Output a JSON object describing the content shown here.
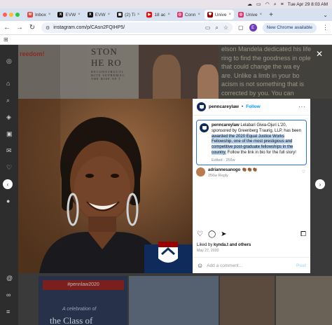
{
  "menubar": {
    "datetime": "Tue Apr 29  8:03 AM"
  },
  "tabs": [
    {
      "label": "Inbox",
      "color": "#ea4335",
      "glyph": "M"
    },
    {
      "label": "EVW",
      "color": "#111111",
      "glyph": "X"
    },
    {
      "label": "EVW",
      "color": "#111111",
      "glyph": "X"
    },
    {
      "label": "(2) Ti",
      "color": "#111111",
      "glyph": "▣"
    },
    {
      "label": "18 ac",
      "color": "#ff0000",
      "glyph": "▶"
    },
    {
      "label": "Conn",
      "color": "#e1306c",
      "glyph": "◎"
    },
    {
      "label": "Unive",
      "color": "#990000",
      "glyph": "⛊"
    },
    {
      "label": "Unive",
      "color": "#e1306c",
      "glyph": "◎"
    }
  ],
  "toolbar": {
    "url": "instagram.com/p/CAsn2FQIHP5/",
    "profile_initial": "E",
    "new_chrome": "New Chrome available"
  },
  "background": {
    "freedom": "reedom!",
    "stone_line1": "STON",
    "stone_line2": "HE RO",
    "stone_line3": "RECONSTRUCTI",
    "stone_line4": "HITE SUPREMAC",
    "stone_line5": "THE RISE OF J",
    "mandela_text": "elson Mandela dedicated his life ring to find the goodness in ople that could change the wa ey are. Unlike a limb in your bo acism is not something that is corrected by you. You can actually",
    "hashtag": "#pennlaw2020",
    "celebration": "A celebration of",
    "class_of": "the Class of"
  },
  "post": {
    "username": "penncareylaw",
    "follow_label": "Follow",
    "caption_user": "penncareylaw",
    "caption_before": " Lelabari Giwa-Ojuri L'20, sponsored by Greenberg Traurig, LLP, has been ",
    "caption_highlight": "awarded the 2020 Equal Justice Works Fellowship, one of the most prestigious and competitive post-graduate fellowships in the country.",
    "caption_after": " Follow the link in bio for the full story!",
    "caption_meta": "Edited · 256w",
    "comment_user": "adriannesanogo",
    "comment_text": "👏🏾👏🏾👏🏾",
    "comment_meta": "256w   Reply",
    "liked_by_prefix": "Liked by ",
    "liked_by_user": "kynda.t",
    "liked_by_suffix": " and others",
    "date": "May 27, 2020",
    "add_comment_placeholder": "Add a comment...",
    "post_label": "Post"
  }
}
